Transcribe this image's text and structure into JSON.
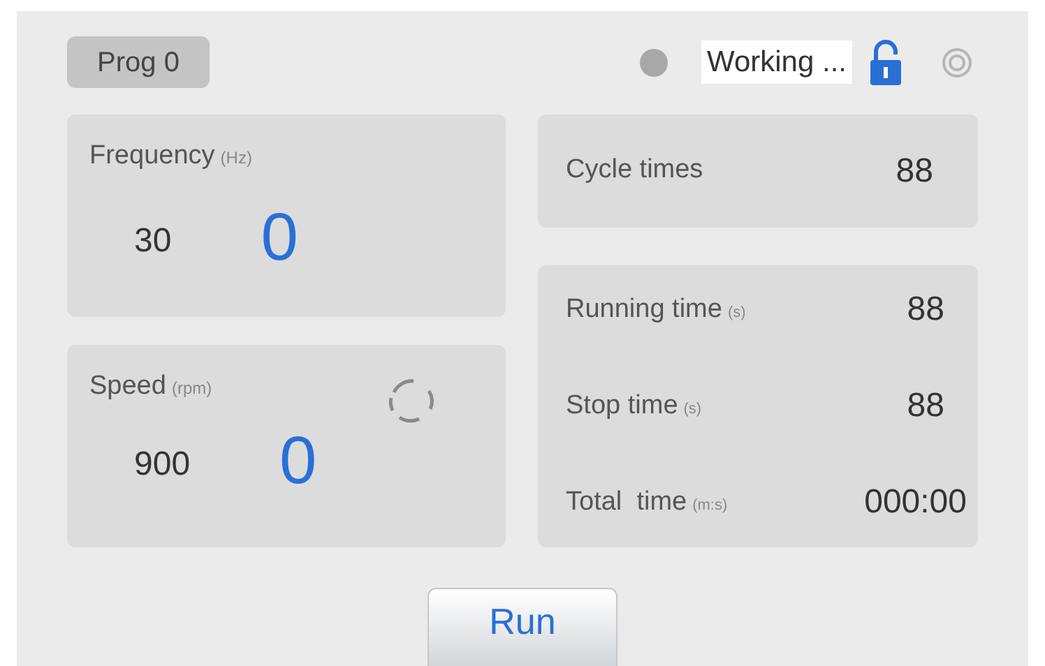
{
  "program": "Prog 0",
  "status": {
    "led_on": false,
    "text": "Working ...",
    "locked": false
  },
  "frequency": {
    "label": "Frequency",
    "unit": "(Hz)",
    "setpoint": "30",
    "actual": "0"
  },
  "speed": {
    "label": "Speed",
    "unit": "(rpm)",
    "setpoint": "900",
    "actual": "0"
  },
  "cycle": {
    "label": "Cycle times",
    "value": "88"
  },
  "times": [
    {
      "label": "Running time",
      "unit": "(s)",
      "value": "88"
    },
    {
      "label": "Stop time",
      "unit": "(s)",
      "value": "88"
    },
    {
      "label": "Total  time",
      "unit": "(m:s)",
      "value": "000:00"
    }
  ],
  "run_button": "Run"
}
